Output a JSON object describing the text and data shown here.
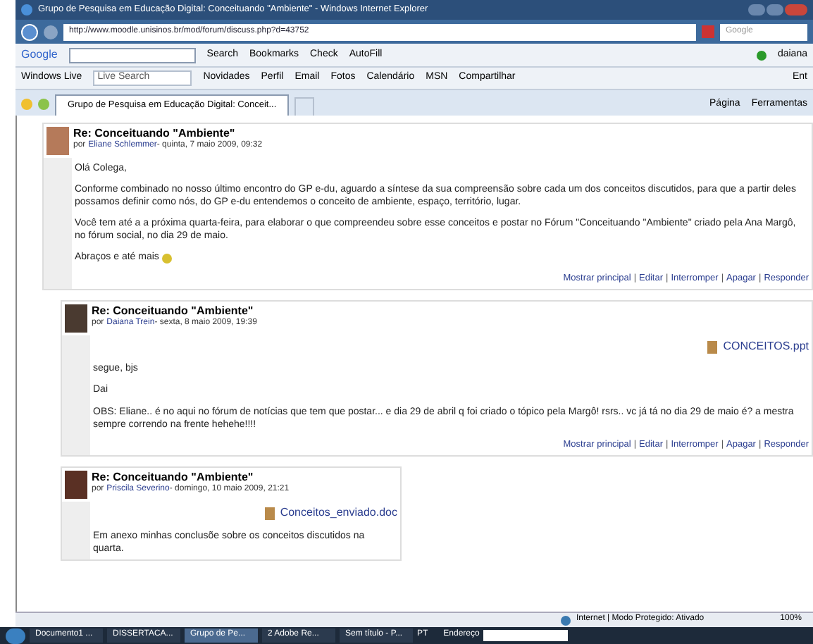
{
  "window": {
    "title": "Grupo de Pesquisa em Educação Digital: Conceituando \"Ambiente\" - Windows Internet Explorer"
  },
  "address_bar": {
    "url": "http://www.moodle.unisinos.br/mod/forum/discuss.php?d=43752",
    "search_placeholder": "Google"
  },
  "google_toolbar": {
    "brand": "Google",
    "items": [
      "Search",
      "Bookmarks",
      "Check",
      "AutoFill"
    ],
    "user": "daiana"
  },
  "live_toolbar": {
    "brand": "Windows Live",
    "search_placeholder": "Live Search",
    "links": [
      "Novidades",
      "Perfil",
      "Email",
      "Fotos",
      "Calendário",
      "MSN",
      "Compartilhar"
    ],
    "right": "Ent"
  },
  "tabs": [
    {
      "label": "Grupo de Pesquisa em Educação Digital: Conceit...",
      "selected": true
    }
  ],
  "command_bar": [
    "Página",
    "Ferramentas"
  ],
  "posts": [
    {
      "subject": "Re: Conceituando \"Ambiente\"",
      "by": "por",
      "author": "Eliane Schlemmer",
      "date": " - quinta, 7 maio 2009, 09:32",
      "paragraphs": [
        "Olá Colega,",
        "Conforme combinado no nosso último encontro do GP e-du, aguardo a síntese da sua compreensão sobre cada um dos conceitos discutidos, para que a partir deles possamos definir como nós, do GP e-du entendemos o conceito de ambiente, espaço, território, lugar.",
        "Você tem até a a próxima quarta-feira, para elaborar o que compreendeu sobre esse conceitos e postar no Fórum \"Conceituando \"Ambiente\" criado pela Ana Margô, no fórum social, no dia 29 de maio.",
        "Abraços e até mais"
      ],
      "smiley": true,
      "actions": [
        "Mostrar principal",
        "|",
        "Editar",
        "|",
        "Interromper",
        "|",
        "Apagar",
        "|",
        "Responder"
      ],
      "children": [
        {
          "subject": "Re: Conceituando \"Ambiente\"",
          "by": "por",
          "author": "Daiana Trein",
          "date": " - sexta, 8 maio 2009, 19:39",
          "attachment": "CONCEITOS.ppt",
          "paragraphs": [
            "segue, bjs",
            "Dai",
            "OBS: Eliane.. é no aqui no fórum de notícias que tem que postar... e dia 29 de abril q foi criado o tópico pela Margô! rsrs.. vc já tá no dia 29 de maio é? a mestra sempre correndo na frente hehehe!!!!"
          ],
          "smiley": false,
          "actions": [
            "Mostrar principal",
            "|",
            "Editar",
            "|",
            "Interromper",
            "|",
            "Apagar",
            "|",
            "Responder"
          ]
        },
        {
          "subject": "Re: Conceituando \"Ambiente\"",
          "by": "por",
          "author": "Priscila Severino",
          "date": " - domingo, 10 maio 2009, 21:21",
          "attachment": "Conceitos_enviado.doc",
          "paragraphs": [
            "Em anexo minhas conclusõe sobre os conceitos discutidos na quarta."
          ],
          "smiley": false
        }
      ]
    }
  ],
  "status_bar": {
    "zone": "Internet | Modo Protegido: Ativado",
    "zoom": "100%"
  },
  "taskbar": {
    "items": [
      {
        "label": "Documento1 ...",
        "selected": false
      },
      {
        "label": "DISSERTACA...",
        "selected": false
      },
      {
        "label": "Grupo de Pe...",
        "selected": true
      },
      {
        "label": "2 Adobe Re...",
        "selected": false
      },
      {
        "label": "Sem título - P...",
        "selected": false
      }
    ],
    "lang": "PT",
    "address_label": "Endereço"
  }
}
